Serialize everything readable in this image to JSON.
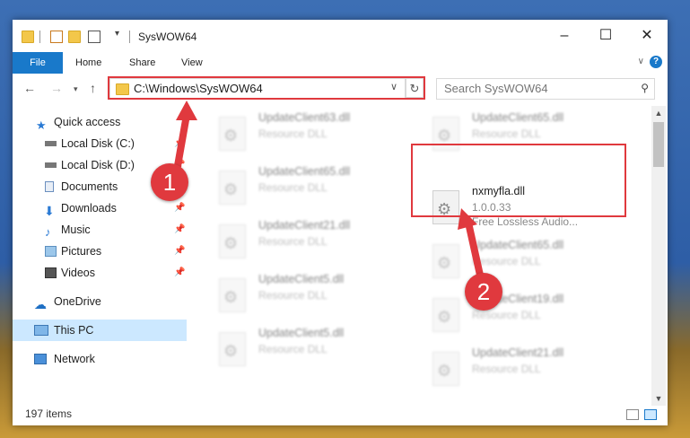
{
  "window": {
    "title": "SysWOW64"
  },
  "ribbon": {
    "tabs": [
      "File",
      "Home",
      "Share",
      "View"
    ],
    "help": "?"
  },
  "nav": {
    "address": "C:\\Windows\\SysWOW64",
    "search_placeholder": "Search SysWOW64"
  },
  "sidebar": {
    "quick_access": "Quick access",
    "items": [
      {
        "label": "Local Disk (C:)"
      },
      {
        "label": "Local Disk (D:)"
      },
      {
        "label": "Documents"
      },
      {
        "label": "Downloads"
      },
      {
        "label": "Music"
      },
      {
        "label": "Pictures"
      },
      {
        "label": "Videos"
      }
    ],
    "onedrive": "OneDrive",
    "this_pc": "This PC",
    "network": "Network"
  },
  "files_left": [
    {
      "name": "UpdateClient63.dll",
      "type": "Resource DLL"
    },
    {
      "name": "UpdateClient65.dll",
      "type": "Resource DLL"
    },
    {
      "name": "UpdateClient21.dll",
      "type": "Resource DLL"
    },
    {
      "name": "UpdateClient5.dll",
      "type": "Resource DLL"
    },
    {
      "name": "UpdateClient5.dll",
      "type": "Resource DLL"
    }
  ],
  "files_right": [
    {
      "name": "UpdateClient65.dll",
      "type": "Resource DLL"
    },
    {
      "name": "UpdateClient65.dll",
      "type": "Resource DLL"
    },
    {
      "name": "UpdateClient19.dll",
      "type": "Resource DLL"
    },
    {
      "name": "UpdateClient21.dll",
      "type": "Resource DLL"
    }
  ],
  "highlighted_file": {
    "name": "nxmyfla.dll",
    "version": "1.0.0.33",
    "description": "Free Lossless Audio..."
  },
  "status": {
    "items": "197 items"
  },
  "badges": {
    "one": "1",
    "two": "2"
  },
  "colors": {
    "accent": "#1979ca",
    "highlight": "#e0393e",
    "selected": "#cce8ff"
  }
}
